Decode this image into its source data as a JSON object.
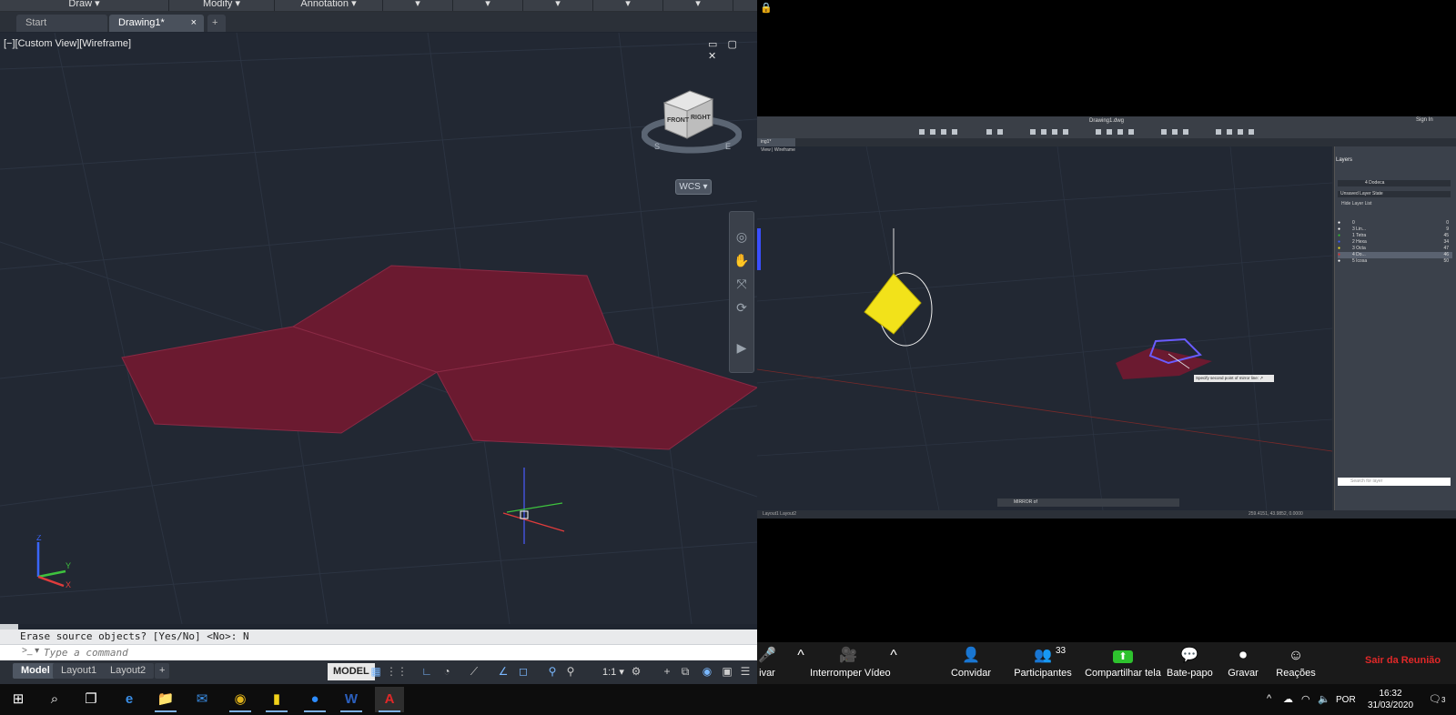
{
  "autocad": {
    "ribbon_panels": [
      "Draw",
      "Modify",
      "Annotation"
    ],
    "doc_tabs": [
      {
        "label": "Start",
        "active": false
      },
      {
        "label": "Drawing1*",
        "active": true
      }
    ],
    "add_tab": "+",
    "close_glyph": "×",
    "viewport_label": "[−][Custom View][Wireframe]",
    "viewport_controls": "▭ ▢ ✕",
    "viewcube": {
      "front": "FRONT",
      "right": "RIGHT",
      "compass_s": "S",
      "compass_e": "E"
    },
    "wcs_label": "WCS",
    "ucs": {
      "x": "X",
      "y": "Y",
      "z": "Z"
    },
    "command_history": "Erase source objects? [Yes/No] <No>: N",
    "command_placeholder": "Type a command",
    "layout_tabs": [
      {
        "label": "Model",
        "active": true
      },
      {
        "label": "Layout1",
        "active": false
      },
      {
        "label": "Layout2",
        "active": false
      }
    ],
    "model_button": "MODEL",
    "scale_label": "1:1",
    "polygon_fill": "#6b1a30",
    "polygon_stroke": "#8a2a45"
  },
  "shared_screen": {
    "title": "Drawing1.dwg",
    "sign_in": "Sign In",
    "doc_tab": "ing1*",
    "viewport_label": "View | Wireframe",
    "tooltip": "Specify second point of mirror line: ↗",
    "command_label": "MIRROR of",
    "status_layouts": "Layout1  Layout2",
    "coordinates": "259.4151, 43.9852, 0.0000",
    "layers_panel": {
      "title": "Layers",
      "current_layer": "4 Dodeca",
      "layer_state": "Unsaved Layer State",
      "hide_list": "Hide Layer List",
      "search_placeholder": "Search for layer",
      "layers": [
        {
          "name": "0",
          "color": "#ffffff",
          "num": "0"
        },
        {
          "name": "3 Lin...",
          "color": "#ffffff",
          "num": "9"
        },
        {
          "name": "1 Tetra",
          "color": "#2ec22e",
          "num": "45"
        },
        {
          "name": "2 Hexa",
          "color": "#3a5cff",
          "num": "34"
        },
        {
          "name": "3 Octa",
          "color": "#f2e21a",
          "num": "47"
        },
        {
          "name": "4 Do...",
          "color": "#e02828",
          "num": "46"
        },
        {
          "name": "5 Icosa",
          "color": "#ffffff",
          "num": "50"
        }
      ]
    }
  },
  "zoom": {
    "controls": [
      {
        "label": "ivar",
        "icon": "🎤"
      },
      {
        "label": "Interromper Vídeo",
        "icon": "🎥"
      },
      {
        "label": "Convidar",
        "icon": "👤"
      },
      {
        "label": "Participantes",
        "icon": "👥",
        "badge": "33"
      },
      {
        "label": "Compartilhar tela",
        "icon": "⬆"
      },
      {
        "label": "Bate-papo",
        "icon": "💬"
      },
      {
        "label": "Gravar",
        "icon": "⏺"
      },
      {
        "label": "Reações",
        "icon": "☺"
      }
    ],
    "caret": "^",
    "leave_label": "Sair da Reunião",
    "share_color": "#2ec22e"
  },
  "taskbar": {
    "apps": [
      {
        "name": "windows-start",
        "glyph": "⊞"
      },
      {
        "name": "search",
        "glyph": "⌕"
      },
      {
        "name": "task-view",
        "glyph": "❐"
      },
      {
        "name": "edge",
        "glyph": "e"
      },
      {
        "name": "file-explorer",
        "glyph": "📁"
      },
      {
        "name": "mail",
        "glyph": "✉"
      },
      {
        "name": "chrome",
        "glyph": "◉"
      },
      {
        "name": "sticky-notes",
        "glyph": "▮"
      },
      {
        "name": "zoom",
        "glyph": "●"
      },
      {
        "name": "word",
        "glyph": "W"
      },
      {
        "name": "autocad",
        "glyph": "A"
      }
    ],
    "language": "POR",
    "time": "16:32",
    "date": "31/03/2020",
    "notifications": "3"
  }
}
